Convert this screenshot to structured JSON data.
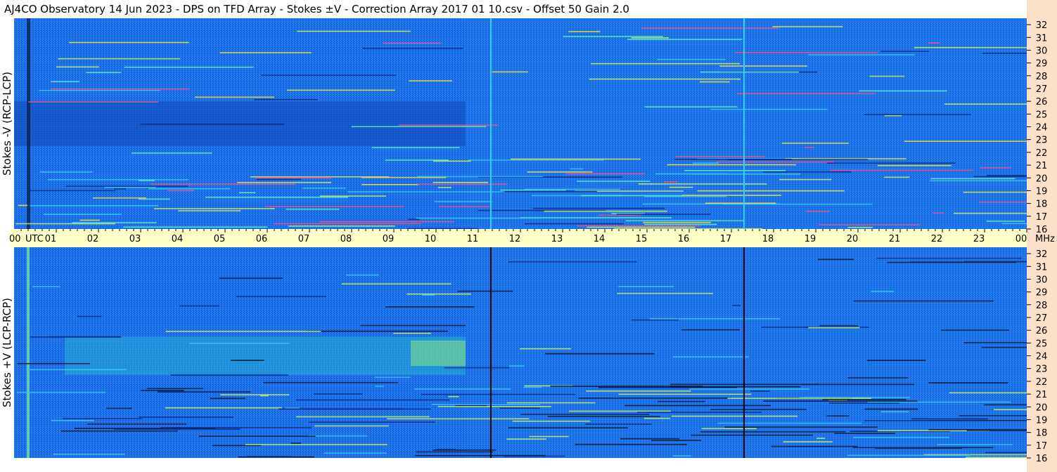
{
  "header": {
    "title": "AJ4CO Observatory  14 Jun 2023  -  DPS on TFD Array  -  Stokes ±V  -  Correction Array 2017 01 10.csv  -  Offset 50  Gain 2.0"
  },
  "colors": {
    "base": "#1c6ee8",
    "time_band": "#ffffc8",
    "freq_strip": "#fde0c8",
    "upper_marker": "#34d2f0",
    "lower_marker": "#000000"
  },
  "chart_data": [
    {
      "type": "heatmap",
      "name": "upper-panel",
      "ylabel": "Stokes -V  (RCP-LCP)",
      "x_unit_labels": [
        "00",
        "UTC"
      ],
      "x_ticks": [
        "01",
        "02",
        "03",
        "04",
        "05",
        "06",
        "07",
        "08",
        "09",
        "10",
        "11",
        "12",
        "13",
        "14",
        "15",
        "16",
        "17",
        "18",
        "19",
        "20",
        "21",
        "22",
        "23",
        "00"
      ],
      "x_end_label": "MHz",
      "xlim": [
        0,
        24
      ],
      "y_ticks": [
        32,
        31,
        30,
        29,
        28,
        27,
        26,
        25,
        24,
        23,
        22,
        21,
        20,
        19,
        18,
        17,
        16
      ],
      "ylim": [
        16,
        32.5
      ],
      "marker_times": [
        11.3,
        17.3
      ]
    },
    {
      "type": "heatmap",
      "name": "lower-panel",
      "ylabel": "Stokes +V  (LCP-RCP)",
      "xlim": [
        0,
        24
      ],
      "y_ticks": [
        32,
        31,
        30,
        29,
        28,
        27,
        26,
        25,
        24,
        23,
        22,
        21,
        20,
        19,
        18,
        17,
        16
      ],
      "ylim": [
        16,
        32.5
      ],
      "marker_times": [
        11.3,
        17.3
      ]
    }
  ]
}
